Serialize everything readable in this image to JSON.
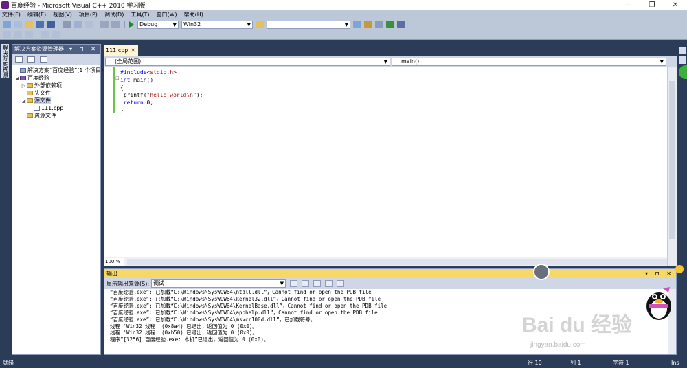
{
  "window": {
    "title": "百度经验 - Microsoft Visual C++ 2010 学习版",
    "min_glyph": "—",
    "max_glyph": "❐",
    "close_glyph": "✕"
  },
  "menu": [
    "文件(F)",
    "编辑(E)",
    "视图(V)",
    "项目(P)",
    "调试(D)",
    "工具(T)",
    "窗口(W)",
    "帮助(H)"
  ],
  "toolbar": {
    "config": "Debug",
    "platform": "Win32",
    "search_value": ""
  },
  "left_tab": "解决方案资源管理器",
  "solution_explorer": {
    "title": "解决方案资源管理器",
    "header_buttons": "▾ ⊓ ✕",
    "tree": [
      {
        "label": "解决方案“百度经验”(1 个项目)",
        "level": 0,
        "twist": "",
        "icon": "solution"
      },
      {
        "label": "百度经验",
        "level": 0,
        "twist": "◢",
        "icon": "project"
      },
      {
        "label": "外部依赖项",
        "level": 1,
        "twist": "▷",
        "icon": "folder"
      },
      {
        "label": "头文件",
        "level": 1,
        "twist": "",
        "icon": "folder"
      },
      {
        "label": "源文件",
        "level": 1,
        "twist": "◢",
        "icon": "folder",
        "selected": true
      },
      {
        "label": "111.cpp",
        "level": 2,
        "twist": "",
        "icon": "file"
      },
      {
        "label": "资源文件",
        "level": 1,
        "twist": "",
        "icon": "folder"
      }
    ]
  },
  "editor": {
    "tab_label": "111.cpp",
    "tab_close": "✕",
    "scope": "(全局范围)",
    "member": "main()",
    "zoom": "100 %",
    "code": [
      {
        "parts": [
          {
            "t": "#include",
            "c": "kw"
          },
          {
            "t": "<stdio.h>",
            "c": "str"
          }
        ]
      },
      {
        "parts": [
          {
            "t": "int",
            "c": "kw"
          },
          {
            "t": " main()",
            "c": ""
          }
        ]
      },
      {
        "parts": [
          {
            "t": "{",
            "c": ""
          }
        ]
      },
      {
        "parts": [
          {
            "t": " printf(",
            "c": ""
          },
          {
            "t": "\"hello world\\n\"",
            "c": "str"
          },
          {
            "t": ");",
            "c": ""
          }
        ]
      },
      {
        "parts": [
          {
            "t": " ",
            "c": ""
          },
          {
            "t": "return",
            "c": "kw"
          },
          {
            "t": " 0;",
            "c": ""
          }
        ]
      },
      {
        "parts": [
          {
            "t": "}",
            "c": ""
          }
        ]
      }
    ]
  },
  "output": {
    "title": "输出",
    "header_buttons": "▾ ⊓ ✕",
    "source_label": "显示输出来源(S):",
    "source_value": "调试",
    "lines": [
      "“百度经验.exe”: 已加载“C:\\Windows\\SysWOW64\\ntdll.dll”，Cannot find or open the PDB file",
      "“百度经验.exe”: 已加载“C:\\Windows\\SysWOW64\\kernel32.dll”，Cannot find or open the PDB file",
      "“百度经验.exe”: 已加载“C:\\Windows\\SysWOW64\\KernelBase.dll”，Cannot find or open the PDB file",
      "“百度经验.exe”: 已加载“C:\\Windows\\SysWOW64\\apphelp.dll”，Cannot find or open the PDB file",
      "“百度经验.exe”: 已加载“C:\\Windows\\SysWOW64\\msvcr100d.dll”，已加载符号。",
      "线程 'Win32 线程' (0x8a4) 已退出，返回值为 0 (0x0)。",
      "线程 'Win32 线程' (0xb50) 已退出，返回值为 0 (0x0)。",
      "程序“[3256] 百度经验.exe: 本机”已退出，返回值为 0 (0x0)。"
    ]
  },
  "status": {
    "ready": "就绪",
    "line": "行 10",
    "col": "列 1",
    "char": "字符 1",
    "ins": "Ins"
  },
  "watermark": {
    "main": "Bai du 经验",
    "sub": "jingyan.baidu.com"
  },
  "colors": {
    "accent": "#2b3c59",
    "output_header": "#f6d868",
    "keyword": "#0000ff",
    "string": "#a31515",
    "change_margin": "#6cc24a"
  }
}
